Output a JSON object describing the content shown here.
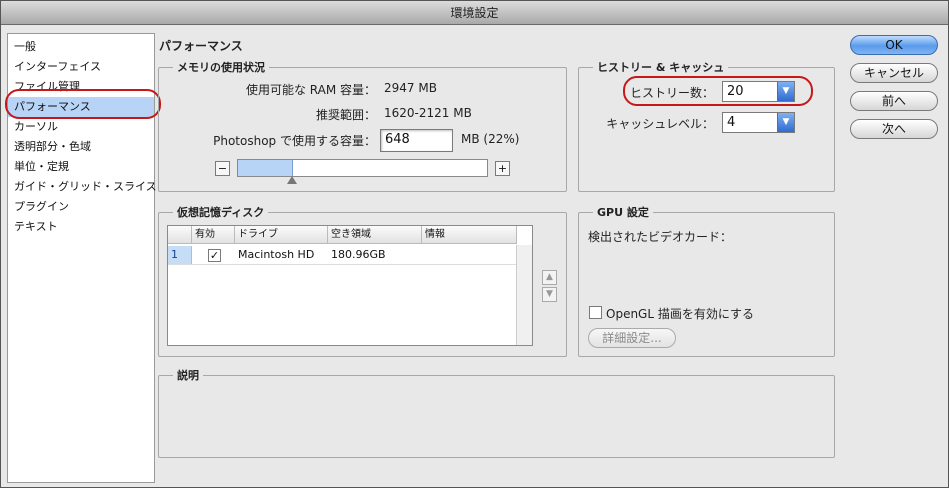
{
  "window": {
    "title": "環境設定"
  },
  "sidebar": {
    "items": [
      {
        "label": "一般"
      },
      {
        "label": "インターフェイス"
      },
      {
        "label": "ファイル管理"
      },
      {
        "label": "パフォーマンス",
        "selected": true
      },
      {
        "label": "カーソル"
      },
      {
        "label": "透明部分・色域"
      },
      {
        "label": "単位・定規"
      },
      {
        "label": "ガイド・グリッド・スライス"
      },
      {
        "label": "プラグイン"
      },
      {
        "label": "テキスト"
      }
    ]
  },
  "main": {
    "section_title": "パフォーマンス",
    "memory": {
      "legend": "メモリの使用状況",
      "ram_label": "使用可能な RAM 容量：",
      "ram_value": "2947 MB",
      "range_label": "推奨範囲：",
      "range_value": "1620-2121 MB",
      "use_label": "Photoshop で使用する容量：",
      "use_value": "648",
      "use_unit": "MB (22%)",
      "slider_percent": 22,
      "minus": "−",
      "plus": "+"
    },
    "history": {
      "legend": "ヒストリー & キャッシュ",
      "history_label": "ヒストリー数：",
      "history_value": "20",
      "cache_label": "キャッシュレベル：",
      "cache_value": "4"
    },
    "scratch": {
      "legend": "仮想記憶ディスク",
      "columns": [
        "有効",
        "ドライブ",
        "空き領域",
        "情報"
      ],
      "rows": [
        {
          "num": "1",
          "check": "✓",
          "drive": "Macintosh HD",
          "free": "180.96GB",
          "info": ""
        }
      ]
    },
    "gpu": {
      "legend": "GPU 設定",
      "detected_label": "検出されたビデオカード：",
      "opengl_label": "OpenGL 描画を有効にする",
      "advanced_label": "詳細設定..."
    },
    "description": {
      "legend": "説明"
    }
  },
  "buttons": {
    "ok": "OK",
    "cancel": "キャンセル",
    "prev": "前へ",
    "next": "次へ"
  },
  "colors": {
    "accent": "#5a9bea",
    "highlight": "#c61818",
    "selected": "#b7d3f5"
  }
}
